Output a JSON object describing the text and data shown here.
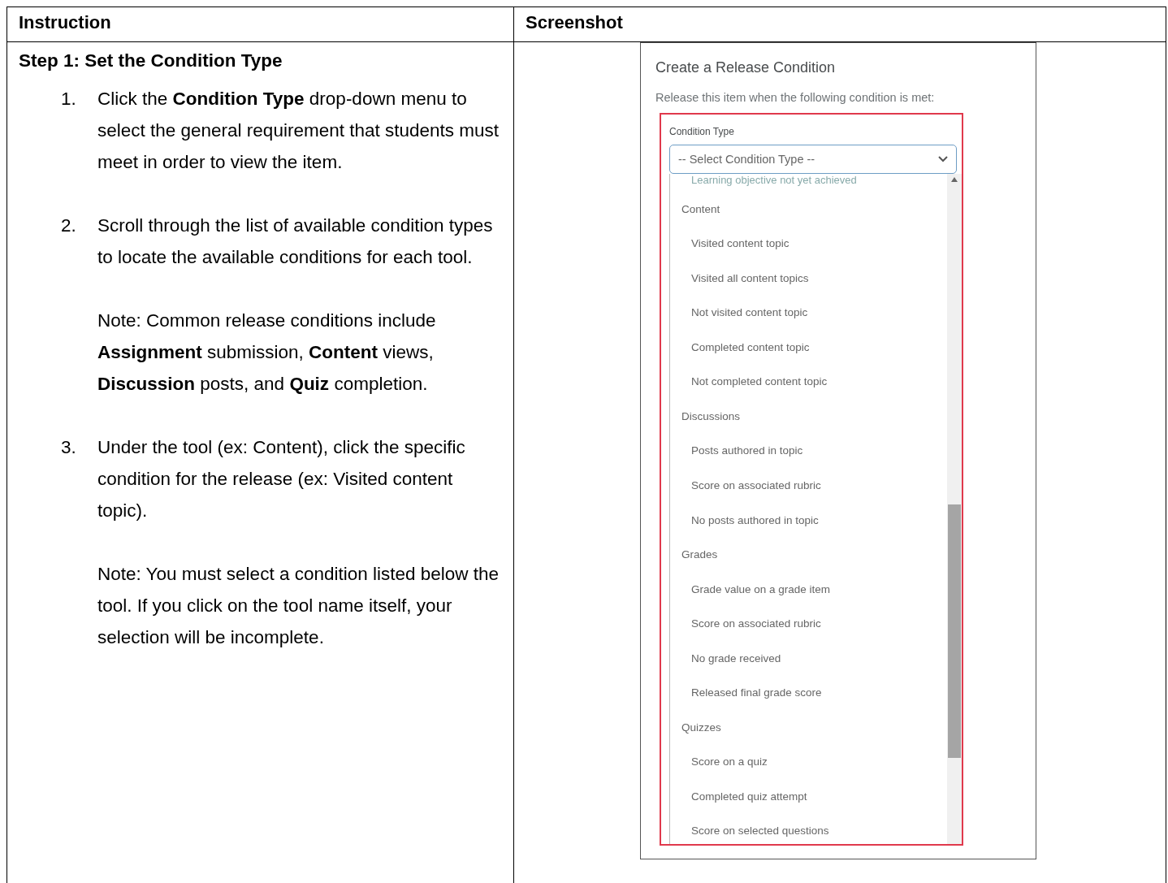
{
  "table": {
    "columns": [
      "Instruction",
      "Screenshot"
    ]
  },
  "step": {
    "title": "Step 1: Set the Condition Type",
    "items": [
      {
        "number": "1.",
        "paragraphs": [
          "Click the **Condition Type** drop-down menu to select the general requirement that students must meet in order to view the item."
        ]
      },
      {
        "number": "2.",
        "paragraphs": [
          "Scroll through the list of available condition types to locate the available conditions for each tool.",
          "Note: Common release conditions include **Assignment** submission, **Content** views, **Discussion** posts, and **Quiz** completion."
        ]
      },
      {
        "number": "3.",
        "paragraphs": [
          "Under the tool (ex: Content), click the specific condition for the release (ex: Visited content topic).",
          "Note: You must select a condition listed below the tool. If you click on the tool name itself, your selection will be incomplete."
        ]
      }
    ]
  },
  "screenshot": {
    "title": "Create a Release Condition",
    "prompt": "Release this item when the following condition is met:",
    "field_label": "Condition Type",
    "select_placeholder": "-- Select Condition Type --",
    "options": [
      {
        "kind": "cut",
        "label": "Learning objective not yet achieved"
      },
      {
        "kind": "group",
        "label": "Content"
      },
      {
        "kind": "option",
        "label": "Visited content topic"
      },
      {
        "kind": "option",
        "label": "Visited all content topics"
      },
      {
        "kind": "option",
        "label": "Not visited content topic"
      },
      {
        "kind": "option",
        "label": "Completed content topic"
      },
      {
        "kind": "option",
        "label": "Not completed content topic"
      },
      {
        "kind": "group",
        "label": "Discussions"
      },
      {
        "kind": "option",
        "label": "Posts authored in topic"
      },
      {
        "kind": "option",
        "label": "Score on associated rubric"
      },
      {
        "kind": "option",
        "label": "No posts authored in topic"
      },
      {
        "kind": "group",
        "label": "Grades"
      },
      {
        "kind": "option",
        "label": "Grade value on a grade item"
      },
      {
        "kind": "option",
        "label": "Score on associated rubric"
      },
      {
        "kind": "option",
        "label": "No grade received"
      },
      {
        "kind": "option",
        "label": "Released final grade score"
      },
      {
        "kind": "group",
        "label": "Quizzes"
      },
      {
        "kind": "option",
        "label": "Score on a quiz"
      },
      {
        "kind": "option",
        "label": "Completed quiz attempt"
      },
      {
        "kind": "option",
        "label": "Score on selected questions"
      }
    ]
  }
}
